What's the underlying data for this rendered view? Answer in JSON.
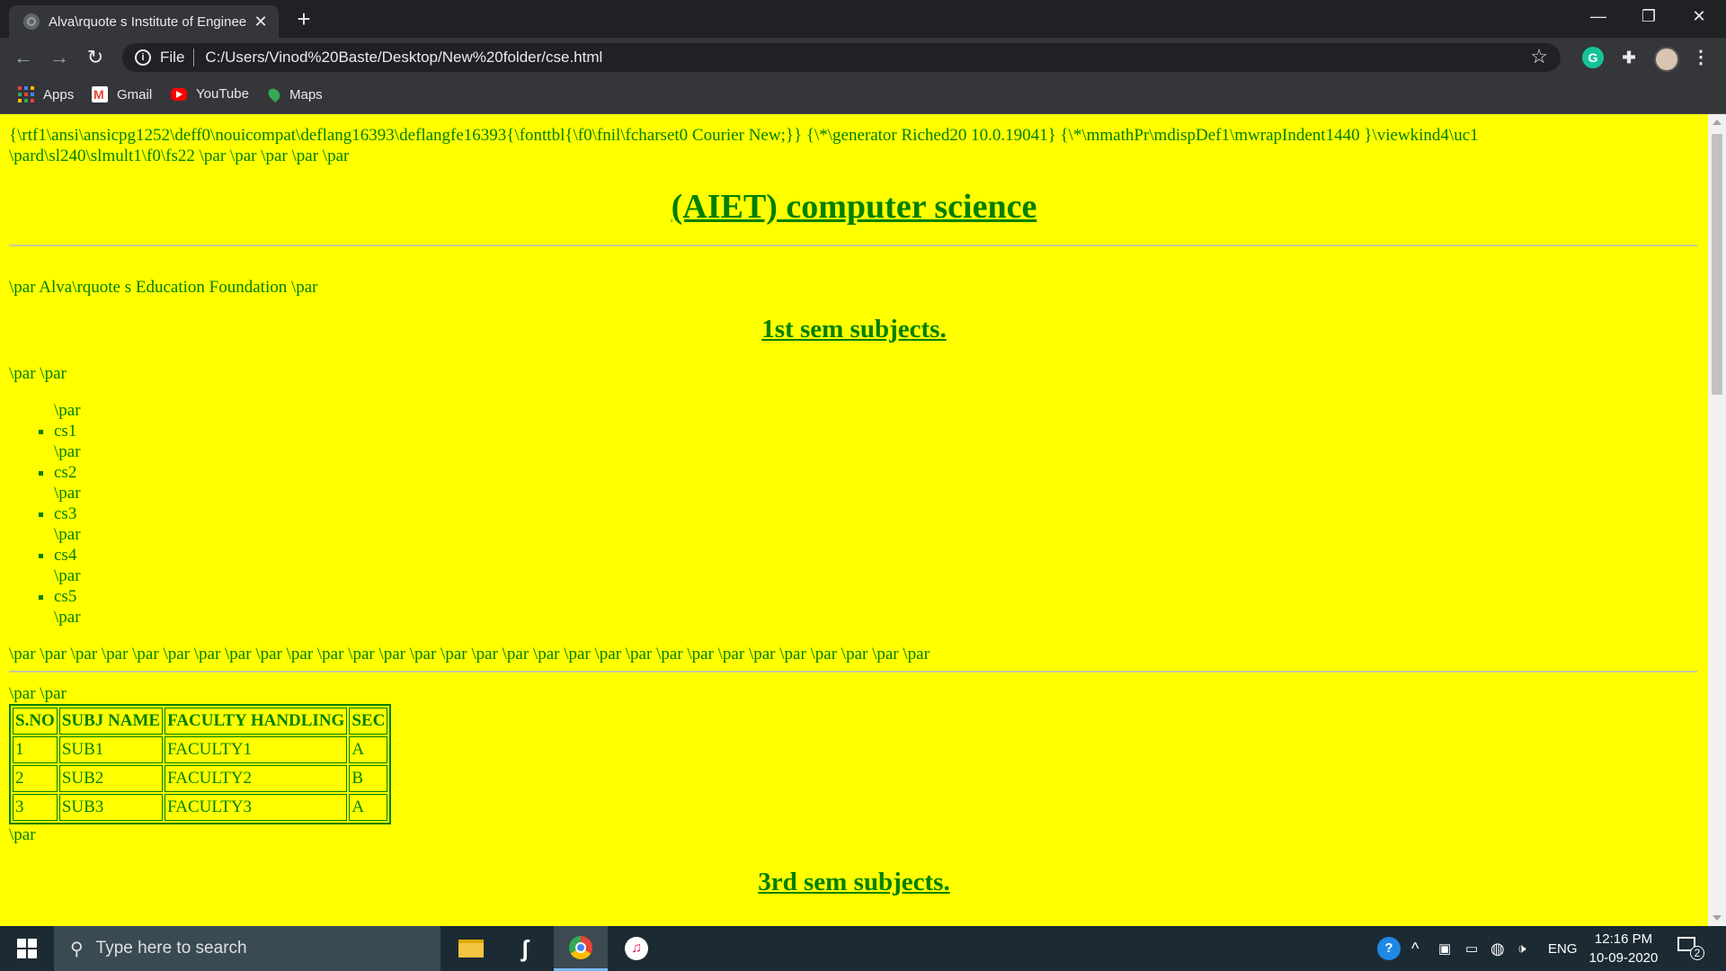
{
  "browser": {
    "tab_title": "Alva\\rquote s Institute of Enginee",
    "address": "C:/Users/Vinod%20Baste/Desktop/New%20folder/cse.html",
    "scheme_label": "File",
    "bookmarks": [
      {
        "label": "Apps",
        "icon": "apps-grid-icon"
      },
      {
        "label": "Gmail",
        "icon": "gmail-icon"
      },
      {
        "label": "YouTube",
        "icon": "youtube-icon"
      },
      {
        "label": "Maps",
        "icon": "maps-icon"
      }
    ]
  },
  "page": {
    "rtf_line1": "{\\rtf1\\ansi\\ansicpg1252\\deff0\\nouicompat\\deflang16393\\deflangfe16393{\\fonttbl{\\f0\\fnil\\fcharset0 Courier New;}} {\\*\\generator Riched20 10.0.19041} {\\*\\mmathPr\\mdispDef1\\mwrapIndent1440 }\\viewkind4\\uc1",
    "rtf_line2": "\\pard\\sl240\\slmult1\\f0\\fs22 \\par \\par \\par \\par \\par",
    "heading": "(AIET) computer science",
    "foundation_line": "\\par Alva\\rquote s Education Foundation \\par",
    "sem1_heading": "1st sem subjects.",
    "par_par": "\\par \\par",
    "par": "\\par",
    "list_items": [
      "cs1",
      "cs2",
      "cs3",
      "cs4",
      "cs5"
    ],
    "long_par_line": "\\par \\par \\par \\par \\par \\par \\par \\par \\par \\par \\par \\par \\par \\par \\par \\par \\par \\par \\par \\par \\par \\par \\par \\par \\par \\par \\par \\par \\par \\par",
    "table_pre": "\\par \\par",
    "table": {
      "headers": [
        "S.NO",
        "SUBJ NAME",
        "FACULTY HANDLING",
        "SEC"
      ],
      "rows": [
        [
          "1",
          "SUB1",
          "FACULTY1",
          "A"
        ],
        [
          "2",
          "SUB2",
          "FACULTY2",
          "B"
        ],
        [
          "3",
          "SUB3",
          "FACULTY3",
          "A"
        ]
      ]
    },
    "table_post": "\\par",
    "sem3_heading": "3rd sem subjects."
  },
  "taskbar": {
    "search_placeholder": "Type here to search",
    "language": "ENG",
    "time": "12:16 PM",
    "date": "10-09-2020",
    "notification_count": "2"
  },
  "colors": {
    "page_bg": "#ffff00",
    "page_text": "#008000"
  }
}
